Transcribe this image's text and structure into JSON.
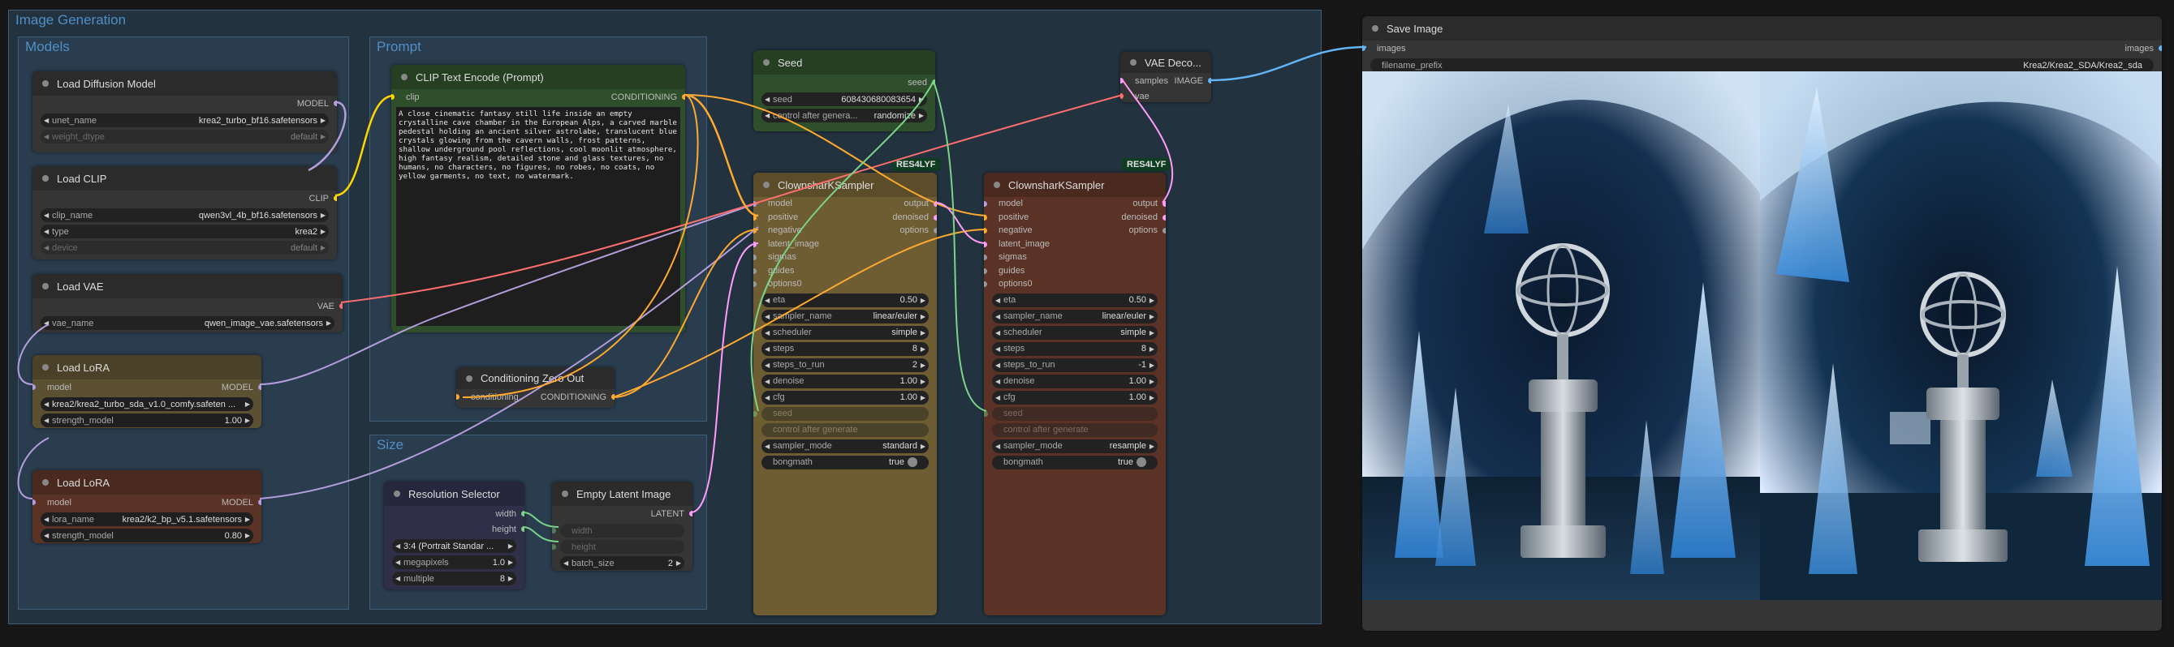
{
  "groups": {
    "main": "Image Generation",
    "models": "Models",
    "prompt": "Prompt",
    "size": "Size"
  },
  "load_diffusion": {
    "title": "Load Diffusion Model",
    "out": "MODEL",
    "unet_name_label": "unet_name",
    "unet_name": "krea2_turbo_bf16.safetensors",
    "weight_dtype_label": "weight_dtype",
    "weight_dtype": "default"
  },
  "load_clip": {
    "title": "Load CLIP",
    "out": "CLIP",
    "clip_name_label": "clip_name",
    "clip_name": "qwen3vl_4b_bf16.safetensors",
    "type_label": "type",
    "type": "krea2",
    "device_label": "device",
    "device": "default"
  },
  "load_vae": {
    "title": "Load VAE",
    "out": "VAE",
    "vae_name_label": "vae_name",
    "vae_name": "qwen_image_vae.safetensors"
  },
  "lora1": {
    "title": "Load LoRA",
    "in_model": "model",
    "out": "MODEL",
    "name": "krea2/krea2_turbo_sda_v1.0_comfy.safeten ...",
    "strength_label": "strength_model",
    "strength": "1.00"
  },
  "lora2": {
    "title": "Load LoRA",
    "in_model": "model",
    "out": "MODEL",
    "name_label": "lora_name",
    "name": "krea2/k2_bp_v5.1.safetensors",
    "strength_label": "strength_model",
    "strength": "0.80"
  },
  "clip_encode": {
    "title": "CLIP Text Encode (Prompt)",
    "in_clip": "clip",
    "out": "CONDITIONING",
    "text": "A close cinematic fantasy still life inside an empty crystalline cave chamber in the European Alps, a carved marble pedestal holding an ancient silver astrolabe, translucent blue crystals glowing from the cavern walls, frost patterns, shallow underground pool reflections, cool moonlit atmosphere, high fantasy realism, detailed stone and glass textures, no humans, no characters, no figures, no robes, no coats, no yellow garments, no text, no watermark."
  },
  "cond_zero": {
    "title": "Conditioning Zero Out",
    "in": "conditioning",
    "out": "CONDITIONING"
  },
  "res_selector": {
    "title": "Resolution Selector",
    "out_width": "width",
    "out_height": "height",
    "aspect": "3:4 (Portrait Standar ...",
    "mp_label": "megapixels",
    "mp": "1.0",
    "multiple_label": "multiple",
    "multiple": "8"
  },
  "empty_latent": {
    "title": "Empty Latent Image",
    "out": "LATENT",
    "width_label": "width",
    "height_label": "height",
    "batch_label": "batch_size",
    "batch": "2"
  },
  "seed": {
    "title": "Seed",
    "out": "seed",
    "seed_label": "seed",
    "seed_value": "608430680083654",
    "control_label": "control after genera...",
    "control_value": "randomize"
  },
  "vae_decode": {
    "title": "VAE Deco...",
    "in_samples": "samples",
    "in_vae": "vae",
    "out": "IMAGE"
  },
  "badge1": "RES4LYF",
  "badge2": "RES4LYF",
  "sampler1": {
    "title": "ClownsharKSampler",
    "inputs": [
      "model",
      "positive",
      "negative",
      "latent_image",
      "sigmas",
      "guides",
      "options0"
    ],
    "outputs": [
      "output",
      "denoised",
      "options"
    ],
    "eta_label": "eta",
    "eta": "0.50",
    "sampler_name_label": "sampler_name",
    "sampler_name": "linear/euler",
    "scheduler_label": "scheduler",
    "scheduler": "simple",
    "steps_label": "steps",
    "steps": "8",
    "steps_to_run_label": "steps_to_run",
    "steps_to_run": "2",
    "denoise_label": "denoise",
    "denoise": "1.00",
    "cfg_label": "cfg",
    "cfg": "1.00",
    "seed_label": "seed",
    "control_label": "control after generate",
    "sampler_mode_label": "sampler_mode",
    "sampler_mode": "standard",
    "bongmath_label": "bongmath",
    "bongmath": "true"
  },
  "sampler2": {
    "title": "ClownsharKSampler",
    "inputs": [
      "model",
      "positive",
      "negative",
      "latent_image",
      "sigmas",
      "guides",
      "options0"
    ],
    "outputs": [
      "output",
      "denoised",
      "options"
    ],
    "eta_label": "eta",
    "eta": "0.50",
    "sampler_name_label": "sampler_name",
    "sampler_name": "linear/euler",
    "scheduler_label": "scheduler",
    "scheduler": "simple",
    "steps_label": "steps",
    "steps": "8",
    "steps_to_run_label": "steps_to_run",
    "steps_to_run": "-1",
    "denoise_label": "denoise",
    "denoise": "1.00",
    "cfg_label": "cfg",
    "cfg": "1.00",
    "seed_label": "seed",
    "control_label": "control after generate",
    "sampler_mode_label": "sampler_mode",
    "sampler_mode": "resample",
    "bongmath_label": "bongmath",
    "bongmath": "true"
  },
  "save_image": {
    "title": "Save Image",
    "in_images": "images",
    "out_images": "images",
    "prefix_label": "filename_prefix",
    "prefix": "Krea2/Krea2_SDA/Krea2_sda"
  },
  "colors": {
    "accent": "#4f8fc6",
    "model_wire": "#b39ddb",
    "clip_wire": "#ffd500",
    "vae_wire": "#ff6e6e",
    "cond_wire": "#ffa931",
    "latent_wire": "#ff9cf9",
    "image_wire": "#64b5f6",
    "int_wire": "#7bd389"
  }
}
